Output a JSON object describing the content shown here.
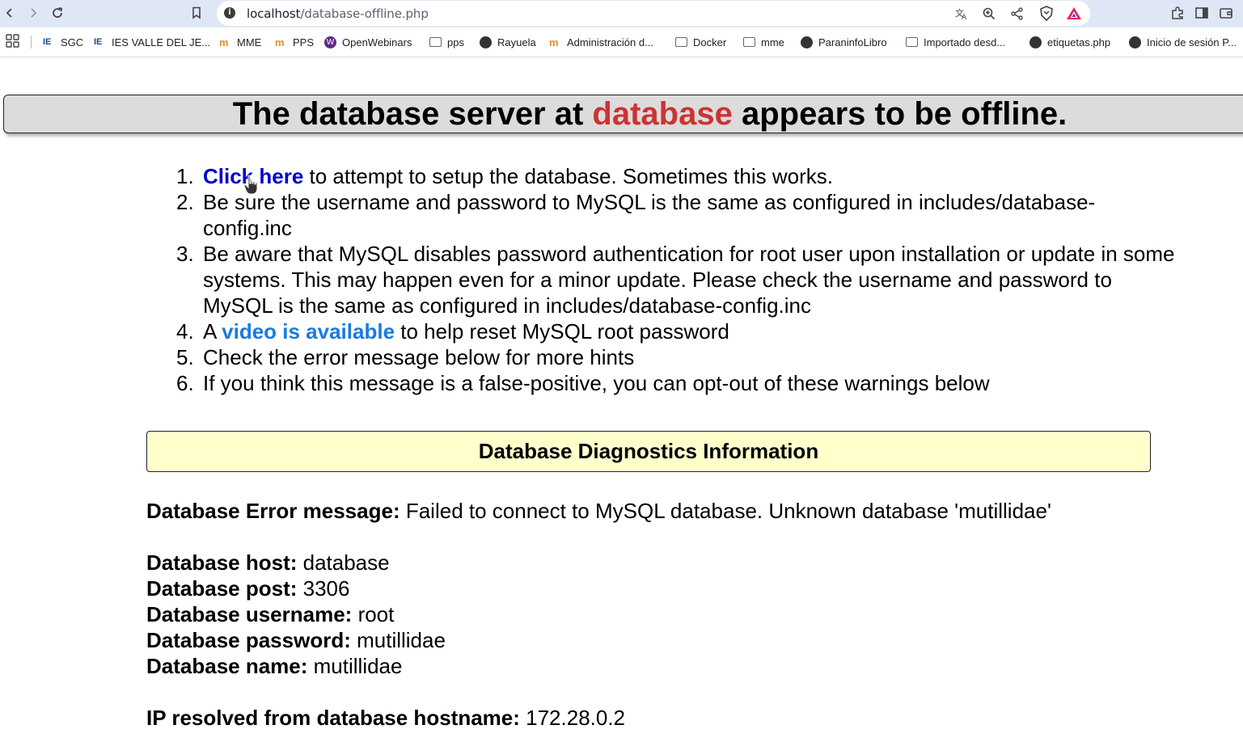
{
  "browser": {
    "url_host": "localhost",
    "url_path": "/database-offline.php",
    "bookmarks": [
      {
        "label": "SGC",
        "icon": "ies-icon"
      },
      {
        "label": "IES VALLE DEL JE...",
        "icon": "ies-icon"
      },
      {
        "label": "MME",
        "icon": "moodle-icon"
      },
      {
        "label": "PPS",
        "icon": "moodle-icon"
      },
      {
        "label": "OpenWebinars",
        "icon": "openwebinars-icon"
      },
      {
        "label": "pps",
        "icon": "folder-icon"
      },
      {
        "label": "Rayuela",
        "icon": "globe-icon"
      },
      {
        "label": "Administración d...",
        "icon": "moodle-icon"
      },
      {
        "label": "Docker",
        "icon": "folder-icon"
      },
      {
        "label": "mme",
        "icon": "folder-icon"
      },
      {
        "label": "ParaninfoLibro",
        "icon": "globe-icon"
      },
      {
        "label": "Importado desd...",
        "icon": "folder-icon"
      },
      {
        "label": "etiquetas.php",
        "icon": "globe-icon"
      },
      {
        "label": "Inicio de sesión P...",
        "icon": "globe-icon"
      }
    ]
  },
  "banner": {
    "prefix": "The database server at ",
    "host": "database",
    "suffix": " appears to be offline."
  },
  "steps": [
    {
      "num": "1.",
      "link": "Click here",
      "text": " to attempt to setup the database. Sometimes this works."
    },
    {
      "num": "2.",
      "text": "Be sure the username and password to MySQL is the same as configured in includes/database-config.inc"
    },
    {
      "num": "3.",
      "text": "Be aware that MySQL disables password authentication for root user upon installation or update in some systems. This may happen even for a minor update. Please check the username and password to MySQL is the same as configured in includes/database-config.inc"
    },
    {
      "num": "4.",
      "before": "A ",
      "link": "video is available",
      "text": " to help reset MySQL root password"
    },
    {
      "num": "5.",
      "text": "Check the error message below for more hints"
    },
    {
      "num": "6.",
      "text": "If you think this message is a false-positive, you can opt-out of these warnings below"
    }
  ],
  "diagnostics": {
    "title": "Database Diagnostics Information",
    "error_label": "Database Error message:",
    "error_value": " Failed to connect to MySQL database. Unknown database 'mutillidae'",
    "host_label": "Database host:",
    "host_value": " database",
    "port_label": "Database post:",
    "port_value": " 3306",
    "username_label": "Database username:",
    "username_value": " root",
    "password_label": "Database password:",
    "password_value": " mutillidae",
    "name_label": "Database name:",
    "name_value": " mutillidae",
    "ip_label": "IP resolved from database hostname:",
    "ip_value": " 172.28.0.2"
  }
}
